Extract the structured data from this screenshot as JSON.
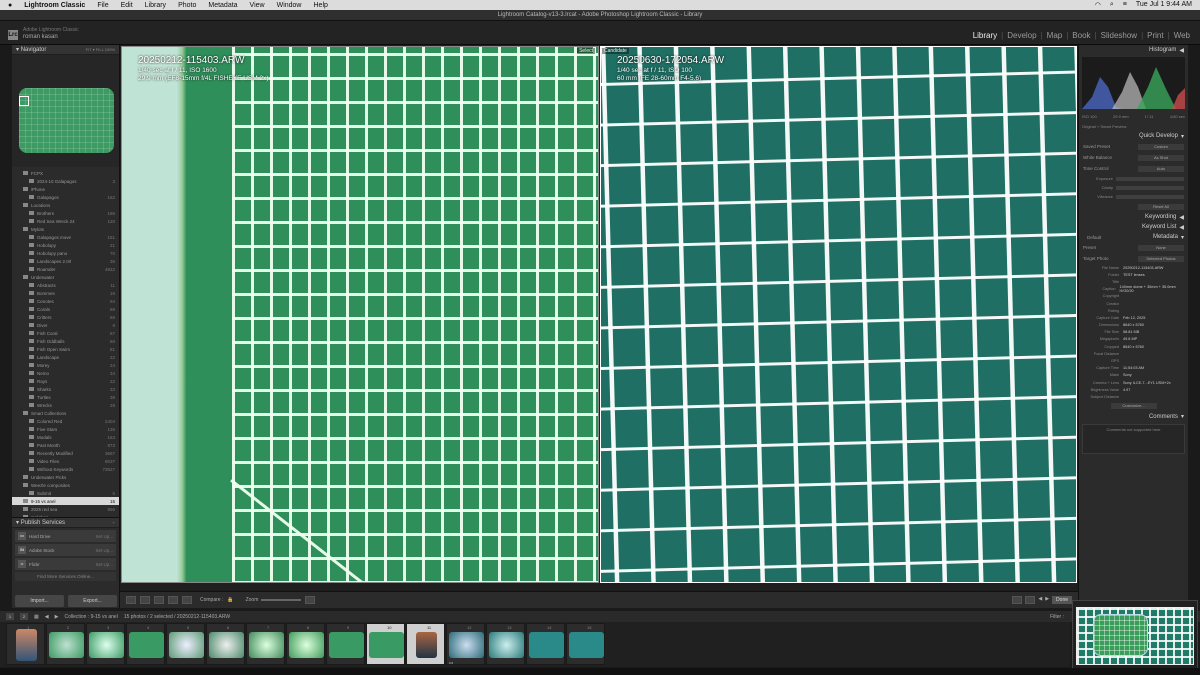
{
  "menubar": {
    "app": "Lightroom Classic",
    "items": [
      "File",
      "Edit",
      "Library",
      "Photo",
      "Metadata",
      "View",
      "Window",
      "Help"
    ],
    "clock": "Tue Jul 1  9:44 AM"
  },
  "titlebar": "Lightroom Catalog-v13-3.lrcat - Adobe Photoshop Lightroom Classic - Library",
  "identity": {
    "logo": "Lrc",
    "product": "Adobe Lightroom Classic",
    "user": "roman kasan"
  },
  "modules": [
    "Library",
    "Develop",
    "Map",
    "Book",
    "Slideshow",
    "Print",
    "Web"
  ],
  "navigator": {
    "title": "Navigator",
    "zoom_opts": "FIT ▾  FILL  100%"
  },
  "collections": [
    {
      "label": "FCPX",
      "n": ""
    },
    {
      "label": "2024-10 Galapagos",
      "n": "3"
    },
    {
      "label": "iPhone",
      "n": ""
    },
    {
      "label": "Galapagos",
      "n": "162"
    },
    {
      "label": "Locations",
      "n": ""
    },
    {
      "label": "Brothers",
      "n": "186"
    },
    {
      "label": "Red Sea Wreck 24",
      "n": "120"
    },
    {
      "label": "Mylots",
      "n": ""
    },
    {
      "label": "Galapagos move",
      "n": "151"
    },
    {
      "label": "Hobolopy",
      "n": "21"
    },
    {
      "label": "Hobolopy pano",
      "n": "70"
    },
    {
      "label": "Landscapes 2.0rl",
      "n": "36"
    },
    {
      "label": "Roamder",
      "n": "4822"
    },
    {
      "label": "Underwater",
      "n": ""
    },
    {
      "label": "Abstracts",
      "n": "11"
    },
    {
      "label": "Bommes",
      "n": "16"
    },
    {
      "label": "Cenotes",
      "n": "94"
    },
    {
      "label": "Corals",
      "n": "69"
    },
    {
      "label": "Critters",
      "n": "68"
    },
    {
      "label": "Diver",
      "n": "8"
    },
    {
      "label": "Fish Coral",
      "n": "67"
    },
    {
      "label": "Fish Oddballs",
      "n": "60"
    },
    {
      "label": "Fish Open Swim",
      "n": "81"
    },
    {
      "label": "Landscape",
      "n": "22"
    },
    {
      "label": "Morey",
      "n": "24"
    },
    {
      "label": "Nemo",
      "n": "34"
    },
    {
      "label": "Rays",
      "n": "22"
    },
    {
      "label": "Sharks",
      "n": "33"
    },
    {
      "label": "Turtles",
      "n": "38"
    },
    {
      "label": "Wrecks",
      "n": "29"
    },
    {
      "label": "Smart Collections",
      "n": ""
    },
    {
      "label": "Colored Red",
      "n": "2404"
    },
    {
      "label": "Five Stars",
      "n": "135"
    },
    {
      "label": "Modals",
      "n": "163"
    },
    {
      "label": "Past Month",
      "n": "873"
    },
    {
      "label": "Recently Modified",
      "n": "3667"
    },
    {
      "label": "Video Files",
      "n": "8037"
    },
    {
      "label": "Without Keywords",
      "n": "73627"
    },
    {
      "label": "Underwater Picks",
      "n": ""
    },
    {
      "label": "Weezle composites",
      "n": ""
    },
    {
      "label": "Submit",
      "n": "5"
    },
    {
      "label": "9-15 vs anel",
      "n": "15"
    },
    {
      "label": "2025 red sea",
      "n": "956"
    },
    {
      "label": "melchoir",
      "n": ""
    }
  ],
  "publish": {
    "title": "Publish Services",
    "services": [
      {
        "logo": "",
        "label": "Hard Drive",
        "status": "Set Up..."
      },
      {
        "logo": "St",
        "label": "Adobe Stock",
        "status": "Set Up..."
      },
      {
        "logo": "",
        "label": "Flickr",
        "status": "Set Up..."
      }
    ],
    "find_more": "Find More Services Online..."
  },
  "import_label": "Import...",
  "export_label": "Export...",
  "image_a": {
    "filename": "20250212-115403.ARW",
    "exposure": "1/40 sec at f / 11, ISO 1600",
    "lens": "29.9 mm (EF8-15mm f/4L FISHEYE USM 2x)",
    "tag": "Select"
  },
  "image_b": {
    "filename": "20250630-172054.ARW",
    "exposure": "1/40 sec at f / 11, ISO 100",
    "lens": "60 mm (FE 28-60mm F4-5.6)",
    "tag": "Candidate"
  },
  "center_toolbar": {
    "compare": "Compare :",
    "zoom": "Zoom",
    "done": "Done"
  },
  "right_panel": {
    "histogram": "Histogram",
    "hist_info": [
      "ISO 100",
      "29.9 mm",
      "f / 11",
      "1/40 sec"
    ],
    "preview": "Original + Smart Preview",
    "quick_develop": "Quick Develop",
    "saved_preset": "Saved Preset",
    "saved_preset_val": "Custom",
    "white_balance": "White Balance",
    "wb_val": "As Shot",
    "tone_control": "Tone Control",
    "tone_val": "Auto",
    "exposure": "Exposure",
    "clarity": "Clarity",
    "vibrance": "Vibrance",
    "reset": "Reset All",
    "keywording": "Keywording",
    "keyword_list": "Keyword List",
    "metadata": "Metadata",
    "preset_default": "Default",
    "preset": "Preset",
    "preset_val": "None",
    "target": "Target Photo",
    "target_val": "Selected Photos",
    "meta": [
      {
        "k": "File Name",
        "v": "20250212-115403.ARW"
      },
      {
        "k": "Folder",
        "v": "TEST lenses"
      },
      {
        "k": "Title",
        "v": ""
      },
      {
        "k": "Caption",
        "v": "140mm dome + 30mm + 35.0mm H/G0/20"
      },
      {
        "k": "Copyright",
        "v": ""
      },
      {
        "k": "Creator",
        "v": ""
      },
      {
        "k": "Rating",
        "v": ""
      },
      {
        "k": "Capture Date",
        "v": "Feb 12, 2025"
      },
      {
        "k": "Dimensions",
        "v": "8640 x 5760"
      },
      {
        "k": "File Size",
        "v": "58.81 MB"
      },
      {
        "k": "Megapixels",
        "v": "49.8 MP"
      },
      {
        "k": "Cropped",
        "v": "8640 x 5760"
      },
      {
        "k": "Focal Distance",
        "v": ""
      },
      {
        "k": "GPS",
        "v": ""
      },
      {
        "k": "Capture Time",
        "v": "11:54:03 AM"
      },
      {
        "k": "Make",
        "v": "Sony"
      },
      {
        "k": "Camera + Lens",
        "v": "Sony ILCE-7...EY1 USM+2x"
      },
      {
        "k": "Brightness Value",
        "v": "4.97"
      },
      {
        "k": "Subject Distance",
        "v": ""
      }
    ],
    "customize": "Customize...",
    "comments": "Comments",
    "comments_note": "Comments not supported here"
  },
  "status": {
    "pages": [
      "1",
      "2"
    ],
    "collection": "Collection : 9-15 vs anel",
    "count": "15 photos / 2 selected / 20250212-115403.ARW",
    "filter": "Filter :"
  },
  "film": [
    "1",
    "2",
    "3",
    "4",
    "5",
    "6",
    "7",
    "8",
    "9",
    "10",
    "11",
    "12",
    "13",
    "14",
    "15"
  ],
  "colors": {
    "bg": "#1a1a1a",
    "panel": "#2b2b2b",
    "greenA": "#2f8f5b",
    "tealB": "#1f6f64"
  }
}
